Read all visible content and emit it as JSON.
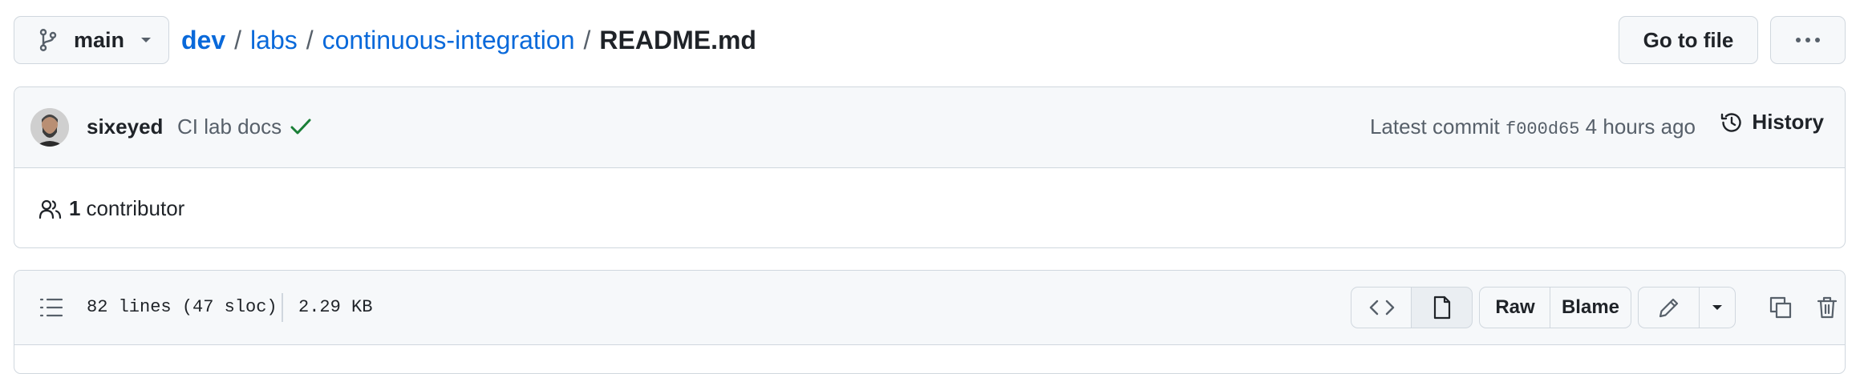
{
  "branch": {
    "name": "main"
  },
  "breadcrumb": {
    "repo": "dev",
    "folder": "labs",
    "subfolder": "continuous-integration",
    "file": "README.md",
    "separator": "/"
  },
  "header_actions": {
    "go_to_file": "Go to file",
    "more": "more-icon"
  },
  "commit": {
    "author": "sixeyed",
    "message": "CI lab docs",
    "status": "success-check-icon",
    "latest_label": "Latest commit",
    "sha": "f000d65",
    "time": "4 hours ago",
    "history_label": "History"
  },
  "contributors": {
    "count": "1",
    "label": "contributor"
  },
  "file_info": {
    "lines": "82 lines (47 sloc)",
    "size": "2.29 KB"
  },
  "file_actions": {
    "code_view": "code-icon",
    "preview_view": "file-icon",
    "raw": "Raw",
    "blame": "Blame",
    "edit": "pencil-icon",
    "edit_menu": "caret-down-icon",
    "copy": "copy-icon",
    "delete": "trash-icon"
  },
  "colors": {
    "link": "#0969da",
    "border": "#d0d7de",
    "success": "#1a7f37",
    "muted": "#57606a"
  }
}
